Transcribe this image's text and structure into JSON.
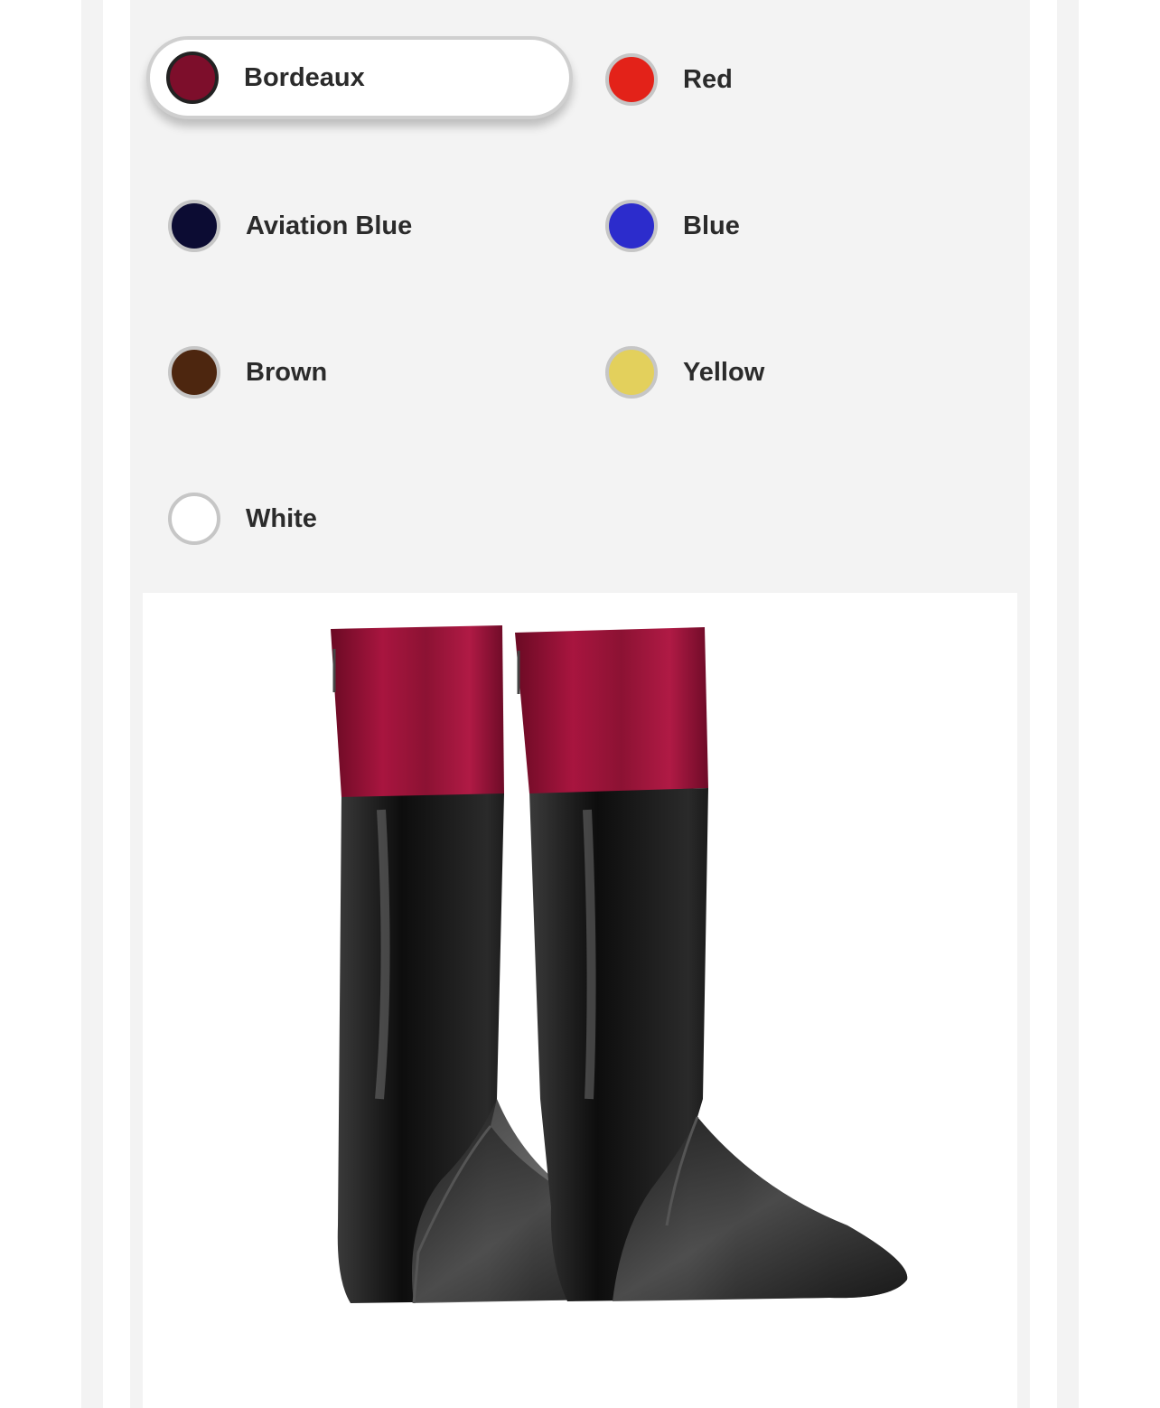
{
  "color_options": {
    "selected": "Bordeaux",
    "items": [
      {
        "label": "Bordeaux",
        "color": "#7d0e2b",
        "selected": true
      },
      {
        "label": "Red",
        "color": "#e32219",
        "selected": false
      },
      {
        "label": "Aviation Blue",
        "color": "#0c0c33",
        "selected": false
      },
      {
        "label": "Blue",
        "color": "#2c2ccc",
        "selected": false
      },
      {
        "label": "Brown",
        "color": "#4d260f",
        "selected": false
      },
      {
        "label": "Yellow",
        "color": "#e3d05c",
        "selected": false
      },
      {
        "label": "White",
        "color": "#ffffff",
        "selected": false
      }
    ]
  },
  "product_image": {
    "subject": "riding-boots",
    "cuff_color": "#8c1233",
    "boot_color": "#111111"
  }
}
